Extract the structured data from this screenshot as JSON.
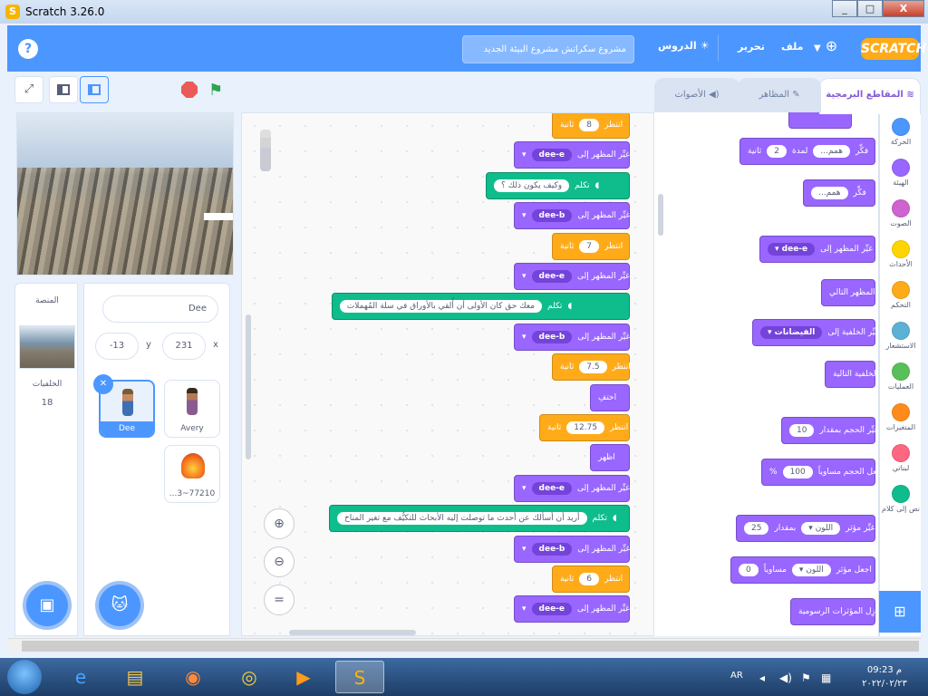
{
  "window": {
    "title": "Scratch 3.26.0",
    "min": "_",
    "max": "□",
    "close": "X"
  },
  "menubar": {
    "help": "?",
    "project_title": "مشروع سكراتش مشروع البيئة الجديد",
    "tutorials": "الدروس",
    "edit": "تحرير",
    "file": "ملف",
    "logo": "SCRATCH"
  },
  "tabs": {
    "code": "المقاطع البرمجية",
    "costumes": "المظاهر",
    "sounds": "الأصوات"
  },
  "stage_panel": {
    "label": "المنصة",
    "backdrops_label": "الخلفيات",
    "backdrops_count": "18"
  },
  "sprite_info": {
    "name": "Dee",
    "x_label": "x",
    "x_value": "231",
    "y_label": "y",
    "y_value": "-13"
  },
  "sprites": [
    {
      "name": "Dee"
    },
    {
      "name": "Avery"
    },
    {
      "name": "...3~77210"
    }
  ],
  "script_blocks": [
    {
      "type": "ctrl",
      "text": "انتظر",
      "value": "8",
      "suffix": "ثانية"
    },
    {
      "type": "looks",
      "text": "غيِّر المظهر إلى",
      "value": "dee-e"
    },
    {
      "type": "say",
      "text": "تكلم",
      "value": "وكيف يكون ذلك ؟"
    },
    {
      "type": "looks",
      "text": "غيِّر المظهر إلى",
      "value": "dee-b"
    },
    {
      "type": "ctrl",
      "text": "انتظر",
      "value": "7",
      "suffix": "ثانية"
    },
    {
      "type": "looks",
      "text": "غيِّر المظهر إلى",
      "value": "dee-e"
    },
    {
      "type": "say",
      "text": "تكلم",
      "value": "معك حق كان الأولى أن أُلقي بالأوراق في سلة المُهملات"
    },
    {
      "type": "looks",
      "text": "غيِّر المظهر إلى",
      "value": "dee-b"
    },
    {
      "type": "ctrl",
      "text": "انتظر",
      "value": "7.5",
      "suffix": "ثانية"
    },
    {
      "type": "looks",
      "text": "اختفِ",
      "value": ""
    },
    {
      "type": "ctrl",
      "text": "انتظر",
      "value": "12.75",
      "suffix": "ثانية"
    },
    {
      "type": "looks",
      "text": "اظهر",
      "value": ""
    },
    {
      "type": "looks",
      "text": "غيِّر المظهر إلى",
      "value": "dee-e"
    },
    {
      "type": "say",
      "text": "تكلم",
      "value": "أريد أن أسألك عن أحدث ما توصلت إليه الأبحاث للتكيُّف مع تغير المناخ"
    },
    {
      "type": "looks",
      "text": "غيِّر المظهر إلى",
      "value": "dee-b"
    },
    {
      "type": "ctrl",
      "text": "انتظر",
      "value": "6",
      "suffix": "ثانية"
    },
    {
      "type": "looks",
      "text": "غيِّر المظهر إلى",
      "value": "dee-e"
    }
  ],
  "palette_blocks": {
    "think_secs": {
      "text": "فكِّر",
      "value": "همم...",
      "mid": "لمدة",
      "num": "2",
      "suffix": "ثانية"
    },
    "think": {
      "text": "فكِّر",
      "value": "همم..."
    },
    "switch_costume": {
      "text": "غيِّر المظهر إلى",
      "value": "dee-e"
    },
    "next_costume": {
      "text": "المظهر التالي"
    },
    "switch_backdrop": {
      "text": "غيِّر الخلفية إلى",
      "value": "الفيضانات"
    },
    "next_backdrop": {
      "text": "الخلفية التالية"
    },
    "change_size": {
      "text": "غيِّر الحجم بمقدار",
      "value": "10"
    },
    "set_size": {
      "text": "اجعل الحجم مساوياً",
      "value": "100",
      "suffix": "%"
    },
    "change_effect": {
      "text": "غيِّر مؤثر",
      "effect": "اللون",
      "mid": "بمقدار",
      "value": "25"
    },
    "set_effect": {
      "text": "اجعل مؤثر",
      "effect": "اللون",
      "mid": "مساوياً",
      "value": "0"
    },
    "clear_effects": {
      "text": "أزِل المؤثرات الرسومية"
    }
  },
  "categories": [
    {
      "name": "الحركة",
      "color": "#4c97ff"
    },
    {
      "name": "الهيئة",
      "color": "#9966ff"
    },
    {
      "name": "الصوت",
      "color": "#cf63cf"
    },
    {
      "name": "الأحداث",
      "color": "#ffd500"
    },
    {
      "name": "التحكم",
      "color": "#ffab19"
    },
    {
      "name": "الاستشعار",
      "color": "#5cb1d6"
    },
    {
      "name": "العمليات",
      "color": "#59c059"
    },
    {
      "name": "المتغيرات",
      "color": "#ff8c1a"
    },
    {
      "name": "لبناتي",
      "color": "#ff6680"
    },
    {
      "name": "نص إلى كلام",
      "color": "#0fbd8c"
    }
  ],
  "taskbar": {
    "lang": "AR",
    "time": "09:23 م",
    "date": "٢٠٢٢/٠٢/٢٣"
  }
}
